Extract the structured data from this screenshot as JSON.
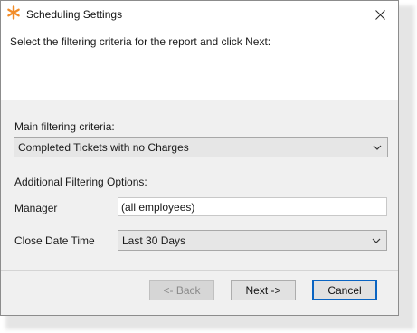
{
  "window": {
    "title": "Scheduling Settings"
  },
  "header": {
    "instruction": "Select the filtering criteria for the report and click Next:"
  },
  "main": {
    "criteria_label": "Main filtering criteria:",
    "criteria_value": "Completed Tickets with no Charges",
    "additional_label": "Additional Filtering Options:",
    "manager_label": "Manager",
    "manager_value": "(all employees)",
    "close_date_label": "Close Date Time",
    "close_date_value": "Last 30 Days"
  },
  "buttons": {
    "back": "<- Back",
    "next": "Next ->",
    "cancel": "Cancel"
  },
  "colors": {
    "accent": "#f28c28",
    "default_border": "#0a64c2"
  },
  "icons": {
    "app": "asterisk-icon",
    "close": "close-icon",
    "dropdown": "chevron-down-icon"
  }
}
